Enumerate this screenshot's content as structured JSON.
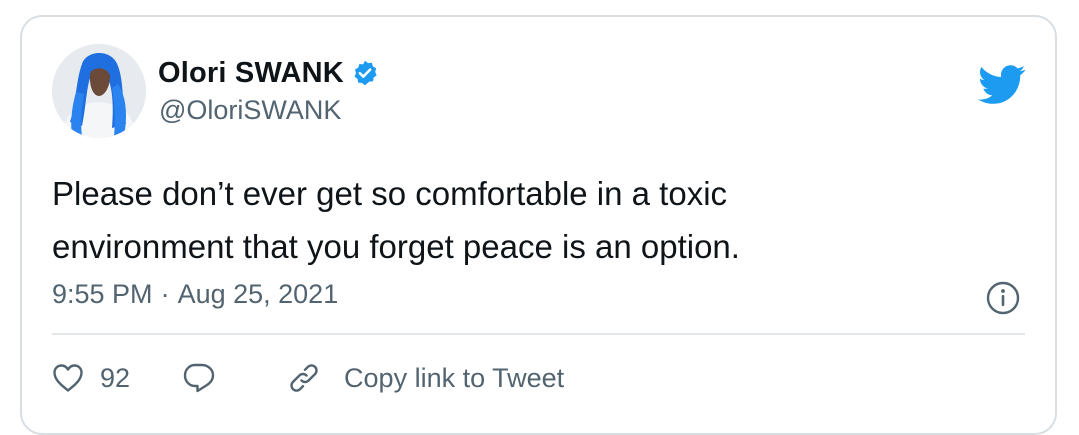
{
  "user": {
    "display_name": "Olori SWANK",
    "handle": "@OloriSWANK",
    "verified": true,
    "avatar_hair_color": "#1f6fe0"
  },
  "tweet": {
    "text": "Please don’t ever get so comfortable in a toxic\nenvironment that you forget peace is an option.",
    "time": "9:55 PM",
    "separator": "·",
    "date": "Aug 25, 2021"
  },
  "actions": {
    "like_count": "92",
    "copy_link_label": "Copy link to Tweet"
  },
  "icons": {
    "brand": "twitter-bird-icon",
    "verified": "verified-badge-icon",
    "info": "info-icon",
    "like": "heart-icon",
    "reply": "reply-bubble-icon",
    "copy_link": "link-icon"
  },
  "colors": {
    "brand_blue": "#1d9bf0",
    "text_primary": "#0f1419",
    "text_secondary": "#536471",
    "border": "#d9dee2"
  }
}
